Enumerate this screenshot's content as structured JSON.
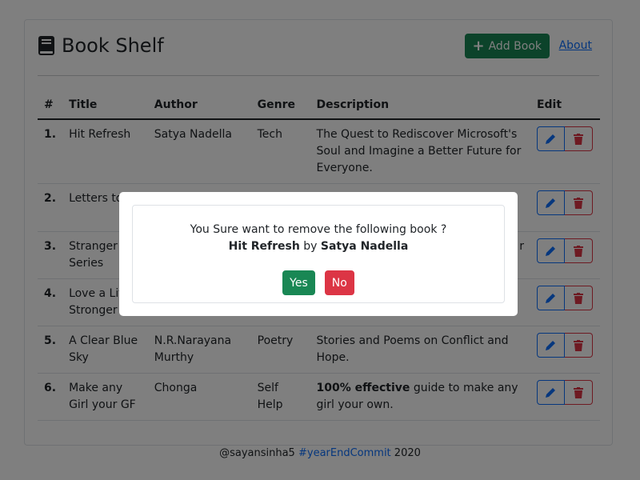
{
  "header": {
    "title": "Book Shelf",
    "add_book_label": "Add Book",
    "about_label": "About"
  },
  "table": {
    "columns": [
      "#",
      "Title",
      "Author",
      "Genre",
      "Description",
      "Edit"
    ],
    "rows": [
      {
        "num": "1.",
        "title": "Hit Refresh",
        "author": "Satya Nadella",
        "genre": "Tech",
        "description": "The Quest to Rediscover Microsoft's Soul and Imagine a Better Future for Everyone."
      },
      {
        "num": "2.",
        "title": "Letters to Ex",
        "author": "",
        "genre": "",
        "description": ""
      },
      {
        "num": "3.",
        "title": "Stranger Series",
        "author": "",
        "genre": "",
        "description": "r"
      },
      {
        "num": "4.",
        "title": "Love a Lit Stronger",
        "author": "",
        "genre": "",
        "description": ""
      },
      {
        "num": "5.",
        "title": "A Clear Blue Sky",
        "author": "N.R.Narayana Murthy",
        "genre": "Poetry",
        "description": "Stories and Poems on Conflict and Hope."
      },
      {
        "num": "6.",
        "title": "Make any Girl your GF",
        "author": "Chonga",
        "genre": "Self Help",
        "description_bold": "100% effective",
        "description": " guide to make any girl your own."
      }
    ]
  },
  "footer": {
    "handle": "@sayansinha5",
    "hashtag": "#yearEndCommit",
    "year": "2020"
  },
  "modal": {
    "question": "You Sure want to remove the following book ?",
    "book_title": "Hit Refresh",
    "by": "by",
    "book_author": "Satya Nadella",
    "yes_label": "Yes",
    "no_label": "No"
  },
  "icons": {
    "title": "book-icon",
    "add": "plus-icon",
    "edit": "pencil-icon",
    "delete": "trash-icon"
  },
  "colors": {
    "success": "#198754",
    "danger": "#dc3545",
    "primary": "#0d6efd"
  }
}
